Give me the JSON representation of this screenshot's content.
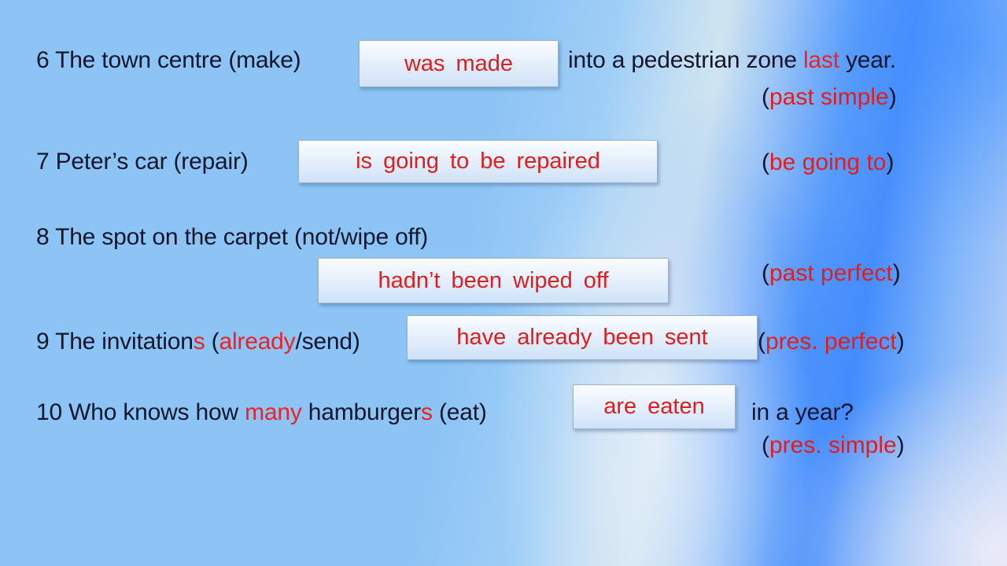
{
  "slide": {
    "background_left_color": "#8cc4f5",
    "background_accent_color": "#4a90fc",
    "answer_text_color": "#e01e1e",
    "body_text_color": "#15152b"
  },
  "exercises": [
    {
      "number": "6",
      "prompt_before": "6 The town centre (make)",
      "answer_words": [
        "was",
        "made"
      ],
      "prompt_after_plain": "into a pedestrian zone ",
      "prompt_after_highlight": "last",
      "prompt_after_tail": " year.",
      "tense_open": "(",
      "tense_label": "past simple",
      "tense_close": ")"
    },
    {
      "number": "7",
      "prompt_before": "7 Peter’s car (repair)",
      "answer_words": [
        "is",
        "going",
        "to",
        "be",
        "repaired"
      ],
      "tense_open": "(",
      "tense_label": "be going to",
      "tense_close": ")"
    },
    {
      "number": "8",
      "prompt_before": "8 The spot on the carpet (not/wipe off)",
      "answer_words": [
        "hadn’t",
        "been",
        "wiped",
        "off"
      ],
      "tense_open": "(",
      "tense_label": "past perfect",
      "tense_close": ")"
    },
    {
      "number": "9",
      "prompt_part1": "9 The invitation",
      "prompt_highlight1": "s",
      "prompt_part2": " (",
      "prompt_highlight2": "already",
      "prompt_part3": "/send)",
      "answer_words": [
        "have",
        "already",
        "been",
        "sent"
      ],
      "tense_open": "(",
      "tense_label": "pres. perfect",
      "tense_close": ")"
    },
    {
      "number": "10",
      "prompt_part1": "10 Who knows how ",
      "prompt_highlight1": "many",
      "prompt_part2": " hamburger",
      "prompt_highlight2": "s",
      "prompt_part3": " (eat)",
      "answer_words": [
        "are",
        "eaten"
      ],
      "prompt_after_tail": "in a year?",
      "tense_open": "(",
      "tense_label": "pres. simple",
      "tense_close": ")"
    }
  ]
}
